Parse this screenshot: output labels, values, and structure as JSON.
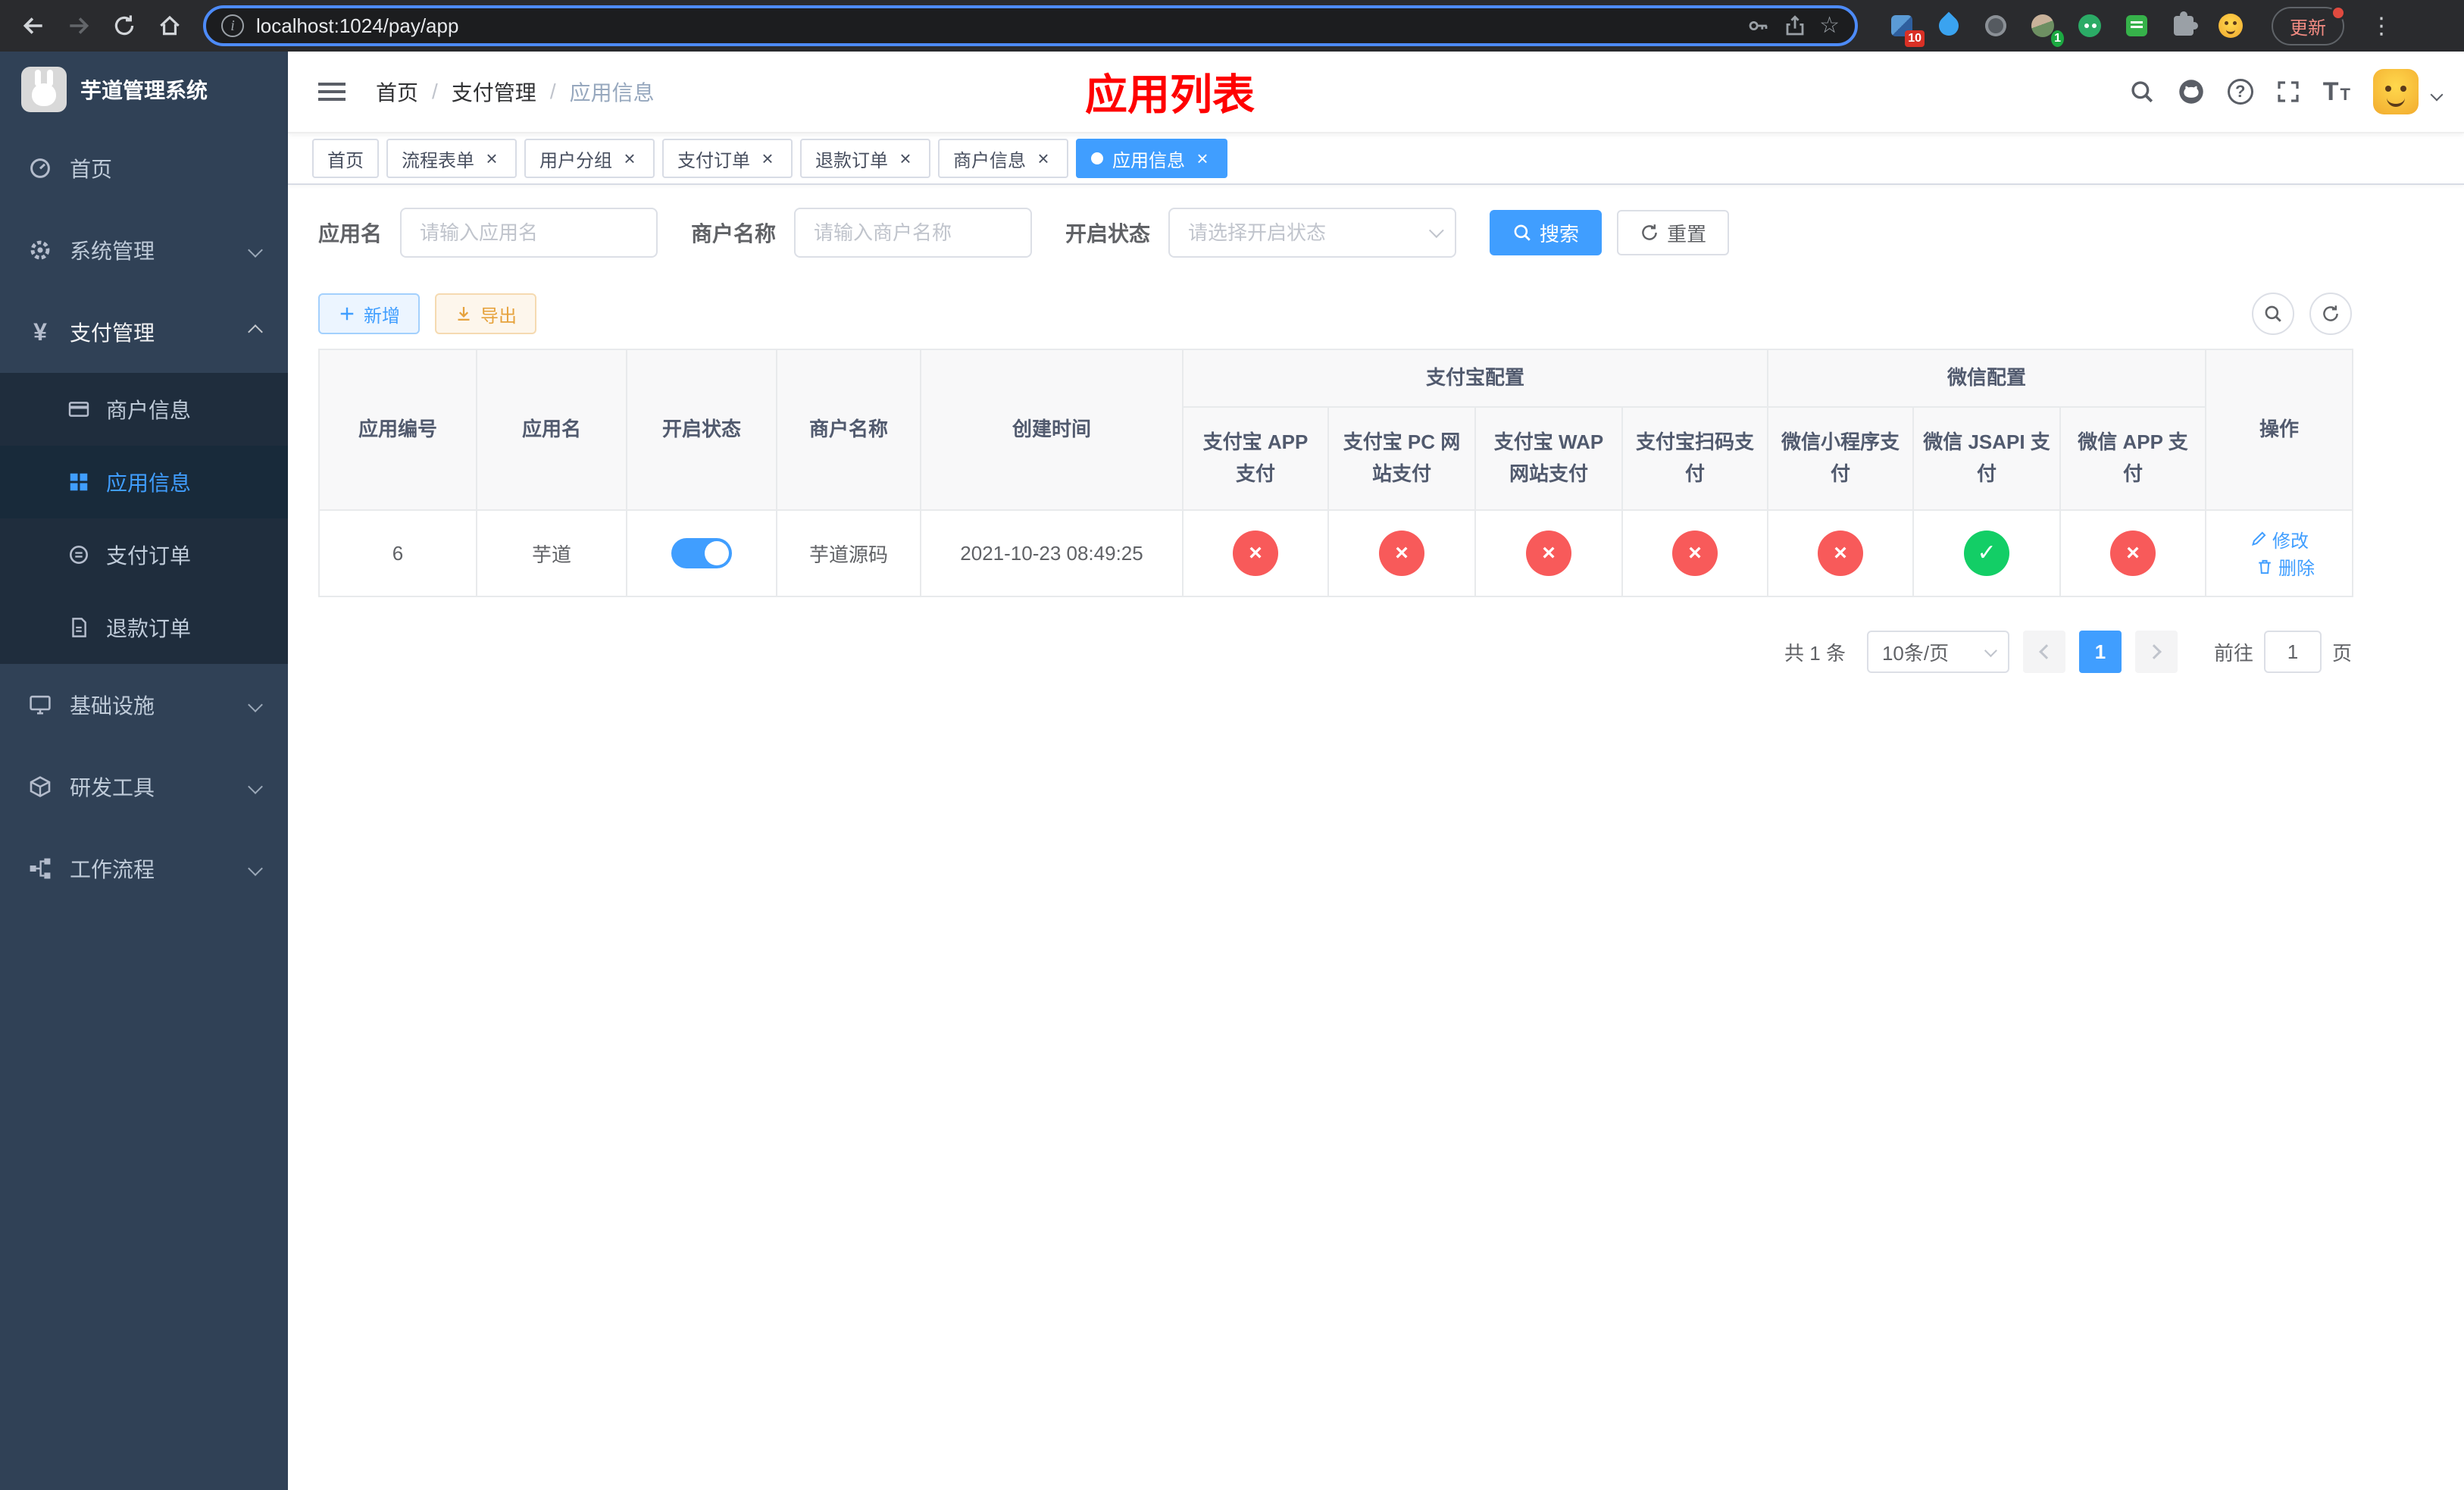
{
  "browser": {
    "url": "localhost:1024/pay/app",
    "update_label": "更新",
    "ext_badge": "10",
    "avatar_badge": "1"
  },
  "sidebar": {
    "title": "芋道管理系统",
    "items": [
      {
        "label": "首页"
      },
      {
        "label": "系统管理"
      },
      {
        "label": "支付管理"
      },
      {
        "label": "基础设施"
      },
      {
        "label": "研发工具"
      },
      {
        "label": "工作流程"
      }
    ],
    "payment_children": [
      {
        "label": "商户信息"
      },
      {
        "label": "应用信息"
      },
      {
        "label": "支付订单"
      },
      {
        "label": "退款订单"
      }
    ]
  },
  "header": {
    "breadcrumb": [
      "首页",
      "支付管理",
      "应用信息"
    ],
    "title": "应用列表",
    "title_color": "#FF0000"
  },
  "tabs": [
    {
      "label": "首页"
    },
    {
      "label": "流程表单"
    },
    {
      "label": "用户分组"
    },
    {
      "label": "支付订单"
    },
    {
      "label": "退款订单"
    },
    {
      "label": "商户信息"
    },
    {
      "label": "应用信息"
    }
  ],
  "filters": {
    "app_name_label": "应用名",
    "app_name_placeholder": "请输入应用名",
    "merchant_label": "商户名称",
    "merchant_placeholder": "请输入商户名称",
    "status_label": "开启状态",
    "status_placeholder": "请选择开启状态",
    "search_label": "搜索",
    "reset_label": "重置"
  },
  "toolbar": {
    "add_label": "新增",
    "export_label": "导出"
  },
  "table": {
    "group_alipay": "支付宝配置",
    "group_wechat": "微信配置",
    "col_app_id": "应用编号",
    "col_app_name": "应用名",
    "col_status": "开启状态",
    "col_merchant": "商户名称",
    "col_created": "创建时间",
    "col_alipay_app": "支付宝 APP 支付",
    "col_alipay_pc": "支付宝 PC 网站支付",
    "col_alipay_wap": "支付宝 WAP 网站支付",
    "col_alipay_qr": "支付宝扫码支付",
    "col_wx_lite": "微信小程序支付",
    "col_wx_jsapi": "微信 JSAPI 支付",
    "col_wx_app": "微信 APP 支付",
    "col_actions": "操作",
    "row": {
      "app_id": "6",
      "app_name": "芋道",
      "status_enabled": true,
      "merchant": "芋道源码",
      "created": "2021-10-23 08:49:25",
      "alipay_app": false,
      "alipay_pc": false,
      "alipay_wap": false,
      "alipay_qr": false,
      "wx_lite": false,
      "wx_jsapi": true,
      "wx_app": false,
      "edit_label": "修改",
      "delete_label": "删除"
    }
  },
  "pagination": {
    "total_label": "共 1 条",
    "page_size_label": "10条/页",
    "current_page": "1",
    "goto_label": "前往",
    "goto_value": "1",
    "page_unit": "页"
  },
  "icons": {
    "close": "×",
    "cross": "×",
    "check": "✓",
    "kebab": "⋮",
    "star": "☆",
    "yen": "¥",
    "info": "i",
    "help": "?",
    "t_big": "T",
    "t_small": "T"
  },
  "colors": {
    "primary": "#409EFF",
    "danger": "#F85A5A",
    "success": "#13CE66",
    "warning": "#E6A23C",
    "sidebar_bg": "#304156",
    "submenu_bg": "#1F2D3D"
  }
}
